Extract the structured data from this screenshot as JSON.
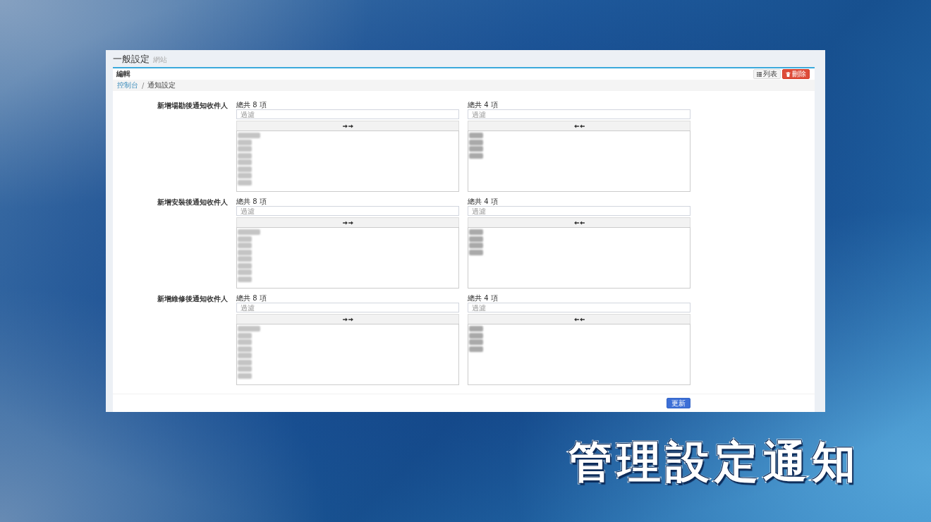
{
  "page_header": {
    "title": "一般設定",
    "subtitle": "網站"
  },
  "box": {
    "title": "編輯",
    "buttons": [
      {
        "kind": "list",
        "label": "列表"
      },
      {
        "kind": "delete",
        "label": "刪除"
      }
    ]
  },
  "breadcrumb": {
    "separator": "/",
    "items": [
      {
        "kind": "link",
        "label": "控制台"
      },
      {
        "kind": "current",
        "label": "通知設定"
      }
    ]
  },
  "fields": [
    {
      "label": "新增場勘後通知收件人",
      "lists": [
        {
          "kind": "source",
          "count": "總共 8 項",
          "placeholder": "過濾",
          "items": [
            {
              "kind": "blurred_long"
            },
            {
              "kind": "blurred"
            },
            {
              "kind": "blurred"
            },
            {
              "kind": "blurred"
            },
            {
              "kind": "blurred"
            },
            {
              "kind": "blurred"
            },
            {
              "kind": "blurred"
            },
            {
              "kind": "blurred"
            }
          ]
        },
        {
          "kind": "target",
          "count": "總共 4 項",
          "placeholder": "過濾",
          "items": [
            {
              "kind": "blurred"
            },
            {
              "kind": "blurred"
            },
            {
              "kind": "blurred"
            },
            {
              "kind": "blurred"
            }
          ]
        }
      ]
    },
    {
      "label": "新增安裝後通知收件人",
      "lists": [
        {
          "kind": "source",
          "count": "總共 8 項",
          "placeholder": "過濾",
          "items": [
            {
              "kind": "blurred_long"
            },
            {
              "kind": "blurred"
            },
            {
              "kind": "blurred"
            },
            {
              "kind": "blurred"
            },
            {
              "kind": "blurred"
            },
            {
              "kind": "blurred"
            },
            {
              "kind": "blurred"
            },
            {
              "kind": "blurred"
            }
          ]
        },
        {
          "kind": "target",
          "count": "總共 4 項",
          "placeholder": "過濾",
          "items": [
            {
              "kind": "blurred"
            },
            {
              "kind": "blurred"
            },
            {
              "kind": "blurred"
            },
            {
              "kind": "blurred"
            }
          ]
        }
      ]
    },
    {
      "label": "新增維修後通知收件人",
      "lists": [
        {
          "kind": "source",
          "count": "總共 8 項",
          "placeholder": "過濾",
          "items": [
            {
              "kind": "blurred_long"
            },
            {
              "kind": "blurred"
            },
            {
              "kind": "blurred"
            },
            {
              "kind": "blurred"
            },
            {
              "kind": "blurred"
            },
            {
              "kind": "blurred"
            },
            {
              "kind": "blurred"
            },
            {
              "kind": "blurred"
            }
          ]
        },
        {
          "kind": "target",
          "count": "總共 4 項",
          "placeholder": "過濾",
          "items": [
            {
              "kind": "blurred"
            },
            {
              "kind": "blurred"
            },
            {
              "kind": "blurred"
            },
            {
              "kind": "blurred"
            }
          ]
        }
      ]
    }
  ],
  "footer": {
    "submit": "更新"
  },
  "caption": "管理設定通知"
}
